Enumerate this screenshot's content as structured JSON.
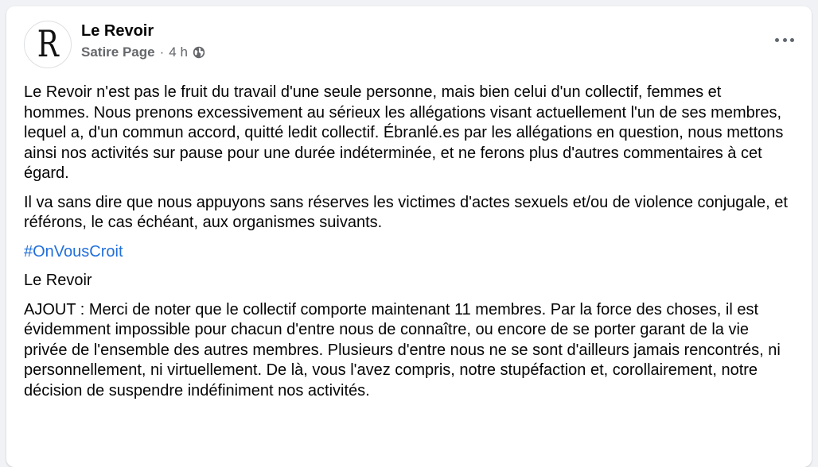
{
  "post": {
    "author": "Le Revoir",
    "avatar_letter": "R",
    "page_type": "Satire Page",
    "separator": "·",
    "time": "4 h",
    "privacy_icon": "globe-icon",
    "more_icon": "more-options-icon",
    "paragraphs": [
      "Le Revoir n'est pas le fruit du travail d'une seule personne, mais bien celui d'un collectif, femmes et hommes. Nous prenons excessivement au sérieux les allégations visant actuellement l'un de ses membres, lequel a, d'un commun accord, quitté ledit collectif. Ébranlé.es par les allégations en question, nous mettons ainsi nos activités sur pause pour une durée indéterminée, et ne ferons plus d'autres commentaires à cet égard.",
      "Il va sans dire que nous appuyons sans réserves les victimes d'actes sexuels et/ou de violence conjugale, et référons, le cas échéant, aux organismes suivants."
    ],
    "hashtag": "#OnVousCroit",
    "signature": "Le Revoir",
    "addendum": "AJOUT : Merci de noter que le collectif comporte maintenant 11 membres. Par la force des choses, il est évidemment impossible pour chacun d'entre nous de connaître, ou encore de se porter garant de la vie privée de l'ensemble des autres membres. Plusieurs d'entre nous ne se sont d'ailleurs jamais rencontrés, ni personnellement, ni virtuellement. De là, vous l'avez compris, notre stupéfaction et, corollairement, notre décision de suspendre indéfiniment nos activités."
  },
  "colors": {
    "background": "#f0f2f5",
    "card": "#ffffff",
    "text": "#050505",
    "secondary_text": "#65676b",
    "link": "#216fdb"
  }
}
